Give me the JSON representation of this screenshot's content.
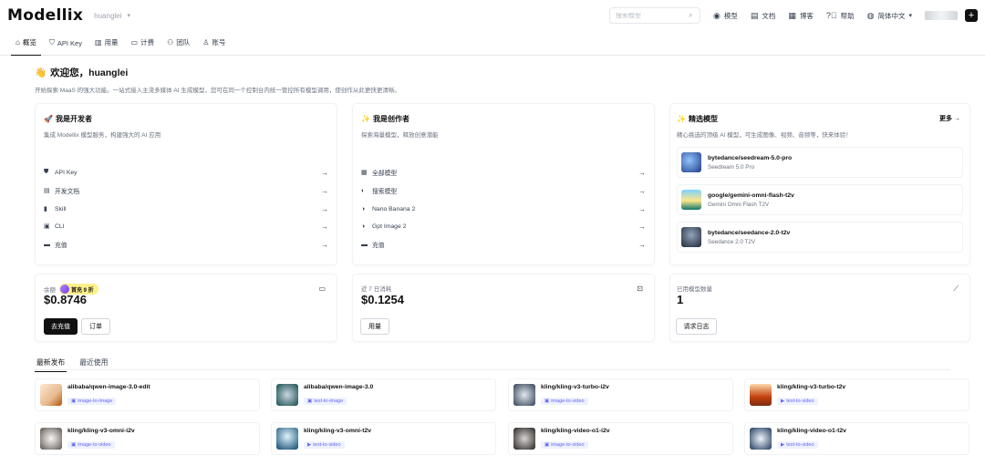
{
  "app": {
    "logo": "Modellix",
    "workspace": "huanglei"
  },
  "header": {
    "search_placeholder": "搜索模型",
    "links": [
      {
        "label": "模型",
        "icon": "globe-icon"
      },
      {
        "label": "文档",
        "icon": "document-icon"
      },
      {
        "label": "博客",
        "icon": "blog-icon"
      },
      {
        "label": "帮助",
        "icon": "help-icon"
      },
      {
        "label": "简体中文",
        "icon": "language-icon"
      }
    ]
  },
  "tabs": [
    {
      "label": "概览",
      "icon": "home-icon",
      "active": true
    },
    {
      "label": "API Key",
      "icon": "shield-icon",
      "active": false
    },
    {
      "label": "用量",
      "icon": "bar-chart-icon",
      "active": false
    },
    {
      "label": "计费",
      "icon": "wallet-icon",
      "active": false
    },
    {
      "label": "团队",
      "icon": "team-icon",
      "active": false
    },
    {
      "label": "账号",
      "icon": "user-icon",
      "active": false
    }
  ],
  "welcome": {
    "emoji": "👋",
    "title": "欢迎您，huanglei",
    "subtitle": "开始探索 MaaS 的强大功能。一站式接入主流多媒体 AI 生成模型，您可在同一个控制台内统一管控所有模型调用，使创作从此更快更清晰。"
  },
  "developer": {
    "emoji": "🚀",
    "title": "我是开发者",
    "subtitle": "集成 Modellix 模型服务，构建强大的 AI 应用",
    "items": [
      {
        "label": "API Key",
        "icon": "shield-icon"
      },
      {
        "label": "开发文档",
        "icon": "document-icon"
      },
      {
        "label": "Skill",
        "icon": "book-icon"
      },
      {
        "label": "CLI",
        "icon": "terminal-icon"
      },
      {
        "label": "充值",
        "icon": "wallet-icon"
      }
    ]
  },
  "creator": {
    "emoji": "✨",
    "title": "我是创作者",
    "subtitle": "探索海量模型，释放创意潜能",
    "items": [
      {
        "label": "全部模型",
        "icon": "grid-icon"
      },
      {
        "label": "搜索模型",
        "icon": "search-icon"
      },
      {
        "label": "Nano Banana 2",
        "icon": "sparkle-icon"
      },
      {
        "label": "Gpt Image 2",
        "icon": "sparkle-icon"
      },
      {
        "label": "充值",
        "icon": "wallet-icon"
      }
    ]
  },
  "featured": {
    "emoji": "✨",
    "title": "精选模型",
    "more": "更多 →",
    "subtitle": "精心挑选的顶级 AI 模型，可生成图像、视频、音频等，快来体验！",
    "models": [
      {
        "name": "bytedance/seedream-5.0-pro",
        "label": "Seedream 5.0 Pro",
        "color1": "#1e3a8a",
        "color2": "#93c5fd"
      },
      {
        "name": "google/gemini-omni-flash-t2v",
        "label": "Gemini Omni Flash T2V",
        "color1": "#0f766e",
        "color2": "#fde68a"
      },
      {
        "name": "bytedance/seedance-2.0-t2v",
        "label": "Seedance 2.0 T2V",
        "color1": "#1e293b",
        "color2": "#94a3b8"
      }
    ]
  },
  "stats": {
    "balance": {
      "label": "余额",
      "badge": "首充 9 折",
      "value": "$0.8746",
      "primary_button": "去充值",
      "secondary_button": "订单"
    },
    "spend": {
      "label": "近 7 日消耗",
      "value": "$0.1254",
      "button": "用量"
    },
    "models_used": {
      "label": "已用模型数量",
      "value": "1",
      "button": "请求日志"
    }
  },
  "lower_tabs": [
    {
      "label": "最新发布",
      "active": true
    },
    {
      "label": "最近使用",
      "active": false
    }
  ],
  "recent_models": [
    {
      "name": "alibaba/qwen-image-3.0-edit",
      "tag": "image-to-image",
      "tag_icon": "image-icon",
      "color1": "#fde7d0",
      "color2": "#b45309"
    },
    {
      "name": "alibaba/qwen-image-3.0",
      "tag": "text-to-image",
      "tag_icon": "image-icon",
      "color1": "#134e4a",
      "color2": "#cbd5e1"
    },
    {
      "name": "kling/kling-v3-turbo-i2v",
      "tag": "image-to-video",
      "tag_icon": "image-icon",
      "color1": "#334155",
      "color2": "#e2e8f0"
    },
    {
      "name": "kling/kling-v3-turbo-t2v",
      "tag": "text-to-video",
      "tag_icon": "video-icon",
      "color1": "#7c2d12",
      "color2": "#fed7aa"
    },
    {
      "name": "kling/kling-v3-omni-i2v",
      "tag": "image-to-video",
      "tag_icon": "image-icon",
      "color1": "#f5f5f4",
      "color2": "#57534e"
    },
    {
      "name": "kling/kling-v3-omni-t2v",
      "tag": "text-to-video",
      "tag_icon": "video-icon",
      "color1": "#0c4a6e",
      "color2": "#e0f2fe"
    },
    {
      "name": "kling/kling-video-o1-i2v",
      "tag": "image-to-video",
      "tag_icon": "image-icon",
      "color1": "#292524",
      "color2": "#d6d3d1"
    },
    {
      "name": "kling/kling-video-o1-t2v",
      "tag": "text-to-video",
      "tag_icon": "video-icon",
      "color1": "#1e3a5f",
      "color2": "#f1f5f9"
    }
  ]
}
